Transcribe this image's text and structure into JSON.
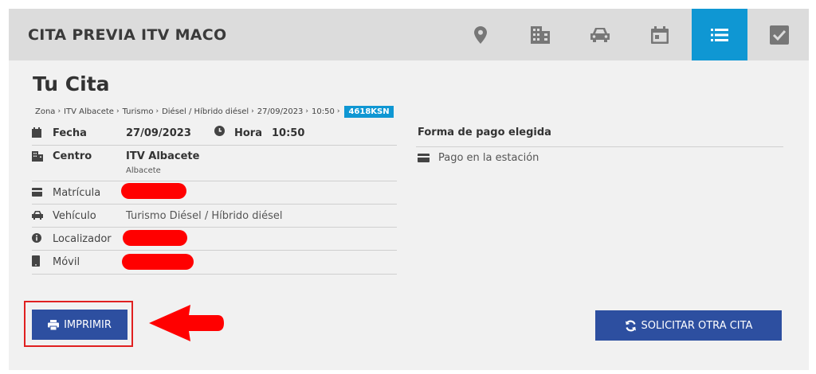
{
  "header": {
    "title": "CITA PREVIA ITV MACO",
    "steps": [
      {
        "icon": "location-pin-icon",
        "active": false
      },
      {
        "icon": "building-icon",
        "active": false
      },
      {
        "icon": "car-icon",
        "active": false
      },
      {
        "icon": "calendar-icon",
        "active": false
      },
      {
        "icon": "list-icon",
        "active": true
      },
      {
        "icon": "checkbox-icon",
        "active": false
      }
    ],
    "active_color": "#0f97d3"
  },
  "page": {
    "heading": "Tu Cita",
    "breadcrumb": [
      "Zona",
      "ITV Albacete",
      "Turismo",
      "Diésel / Híbrido diésel",
      "27/09/2023",
      "10:50"
    ],
    "plate": "4618KSN"
  },
  "details": {
    "fecha_label": "Fecha",
    "fecha_value": "27/09/2023",
    "hora_label": "Hora",
    "hora_value": "10:50",
    "centro_label": "Centro",
    "centro_value": "ITV Albacete",
    "centro_sub": "Albacete",
    "matricula_label": "Matrícula",
    "vehiculo_label": "Vehículo",
    "vehiculo_value": "Turismo Diésel / Híbrido diésel",
    "localizador_label": "Localizador",
    "movil_label": "Móvil"
  },
  "payment": {
    "title": "Forma de pago elegida",
    "method": "Pago en la estación"
  },
  "actions": {
    "print_label": "IMPRIMIR",
    "new_appointment_label": "SOLICITAR OTRA CITA",
    "button_color": "#2d4fa0",
    "highlight_color": "#e02020"
  }
}
